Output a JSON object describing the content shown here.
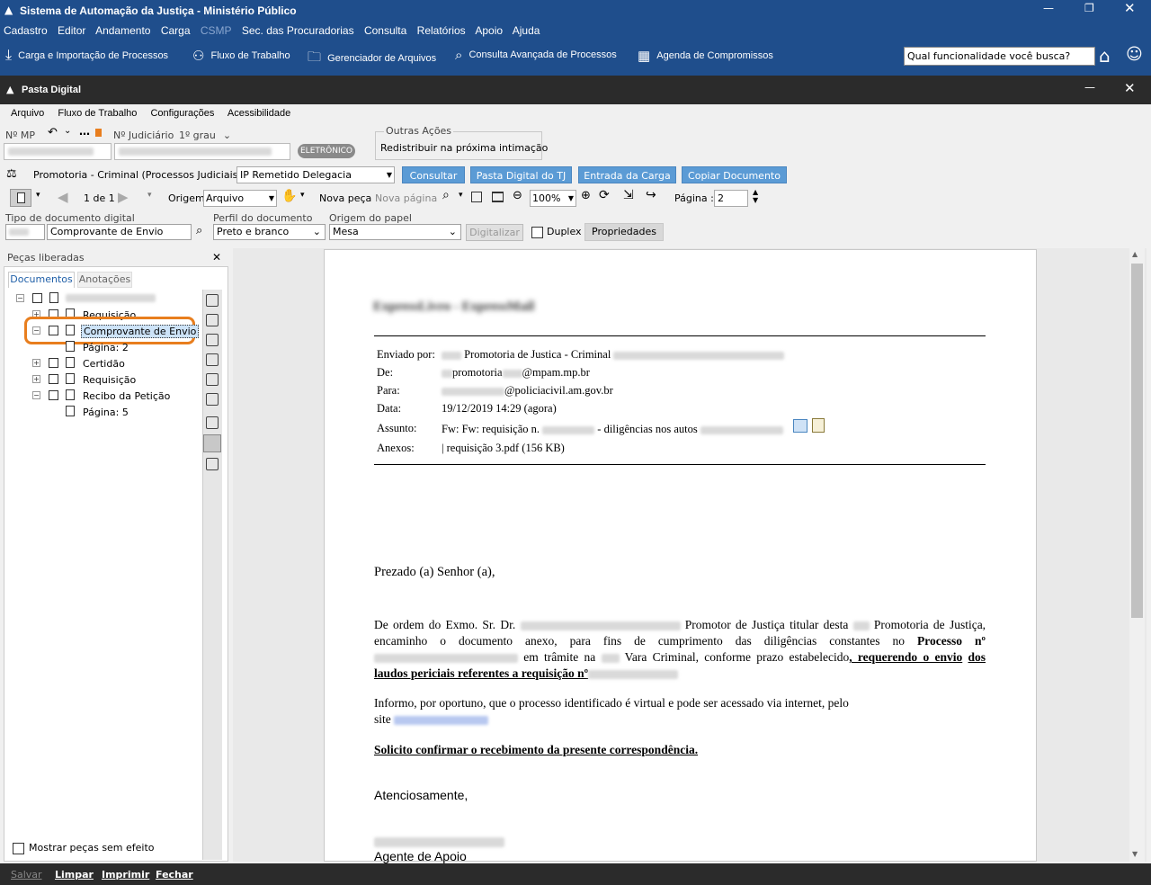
{
  "app": {
    "title": "Sistema de Automação da Justiça - Ministério Público",
    "menu": [
      "Cadastro",
      "Editor",
      "Andamento",
      "Carga",
      "CSMP",
      "Sec. das Procuradorias",
      "Consulta",
      "Relatórios",
      "Apoio",
      "Ajuda"
    ],
    "toolbar": [
      "Carga e Importação de Processos",
      "Fluxo de Trabalho",
      "Gerenciador de Arquivos",
      "Consulta Avançada de Processos",
      "Agenda de Compromissos"
    ],
    "search_value": "Qual funcionalidade você busca?"
  },
  "pasta": {
    "title": "Pasta Digital",
    "menu": [
      "Arquivo",
      "Fluxo de Trabalho",
      "Configurações",
      "Acessibilidade"
    ],
    "nmp_label": "Nº MP",
    "njud_label": "Nº Judiciário",
    "grau_value": "1º grau",
    "badge": "ELETRÔNICO",
    "outras_label": "Outras Ações",
    "outras_value": "Redistribuir na próxima intimação",
    "fila_label": "Promotoria - Criminal (Processos Judiciais) - Fila",
    "fila_value": "IP Remetido Delegacia",
    "actions": [
      "Consultar",
      "Pasta Digital do TJ",
      "Entrada da Carga",
      "Copiar Documento"
    ],
    "page_count": "1 de 1",
    "origem_label": "Origem",
    "origem_value": "Arquivo",
    "nova_peca": "Nova peça",
    "nova_pagina": "Nova página",
    "zoom": "100%",
    "pagina_label": "Página :",
    "pagina_value": "2",
    "tipo_label": "Tipo de documento digital",
    "tipo_value": "Comprovante de Envio",
    "perfil_label": "Perfil do documento",
    "perfil_value": "Preto e branco",
    "origem_papel_label": "Origem do papel",
    "origem_papel_value": "Mesa",
    "digitalizar": "Digitalizar",
    "duplex": "Duplex",
    "propriedades": "Propriedades"
  },
  "panel": {
    "title": "Peças liberadas",
    "tabs": [
      "Documentos",
      "Anotações"
    ],
    "tree": [
      "Requisição",
      "Comprovante de Envio",
      "Página: 2",
      "Certidão",
      "Requisição",
      "Recibo da Petição",
      "Página: 5"
    ],
    "footer_check": "Mostrar peças sem efeito"
  },
  "doc": {
    "heading": "ExpressLivro - ExpressMail",
    "labels": [
      "Enviado por:",
      "De:",
      "Para:",
      "Data:",
      "Assunto:",
      "Anexos:"
    ],
    "enviado": "Promotoria de Justica - Criminal",
    "de": "promotoria",
    "de_domain": "@mpam.mp.br",
    "para": "@policiacivil.am.gov.br",
    "data": "19/12/2019 14:29 (agora)",
    "assunto_a": "Fw: Fw: requisição n.",
    "assunto_b": "- diligências nos autos",
    "anexos": "| requisição 3.pdf (156 KB)",
    "greeting": "Prezado (a) Senhor (a),",
    "p1_a": "De ordem do Exmo. Sr. Dr.",
    "p1_b": "Promotor de Justiça titular desta",
    "p1_c": "Promotoria de",
    "p1_d": "Justiça, encaminho o documento anexo, para fins de cumprimento das diligências constantes no",
    "p1_bold": "Processo nº",
    "p1_e": "em trâmite na",
    "p1_f": "Vara Criminal, conforme prazo estabelecido",
    "p1_ul1": ", requerendo o envio",
    "p1_ul2": "dos laudos periciais referentes a requisição nº",
    "p2": "Informo, por oportuno, que o processo identificado é virtual e pode ser acessado via internet, pelo",
    "p2_site": "site",
    "p3": "Solicito confirmar o recebimento da presente correspondência.",
    "closing": "Atenciosamente,",
    "role": "Agente de Apoio"
  },
  "footer": [
    "Salvar",
    "Limpar",
    "Imprimir",
    "Fechar"
  ],
  "colors": {
    "titlebar": "#1f4e8c",
    "darkbar": "#2b2b2b",
    "accent": "#5b9bd5",
    "highlight": "#e87e1e"
  }
}
